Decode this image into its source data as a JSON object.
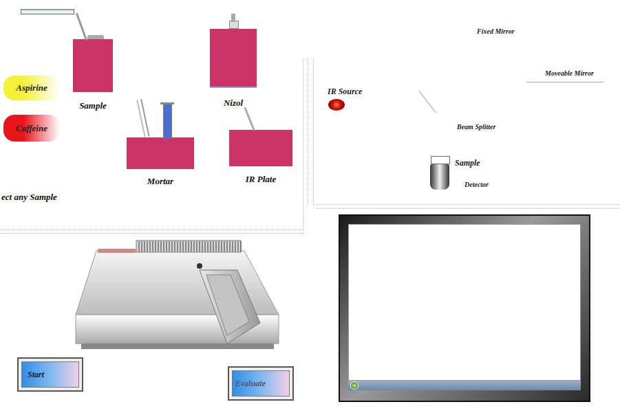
{
  "samples": [
    {
      "label": "Aspirine",
      "color": "#f5f03a"
    },
    {
      "label": "Caffeine",
      "color": "#e8141a"
    }
  ],
  "lab_items": [
    {
      "label": "Sample",
      "kind": "beaker"
    },
    {
      "label": "Nizol",
      "kind": "bottle"
    },
    {
      "label": "Mortar",
      "kind": "tube"
    },
    {
      "label": "IR Plate",
      "kind": "plate"
    }
  ],
  "hint": "ect any Sample",
  "interferometer": [
    {
      "label": "Fixed Mirror"
    },
    {
      "label": "Moveable Mirror"
    },
    {
      "label": "IR Source"
    },
    {
      "label": "Beam Splitter"
    },
    {
      "label": "Sample"
    },
    {
      "label": "Detector"
    }
  ],
  "buttons": [
    {
      "label": "Start"
    },
    {
      "label": "Evaluate"
    }
  ]
}
